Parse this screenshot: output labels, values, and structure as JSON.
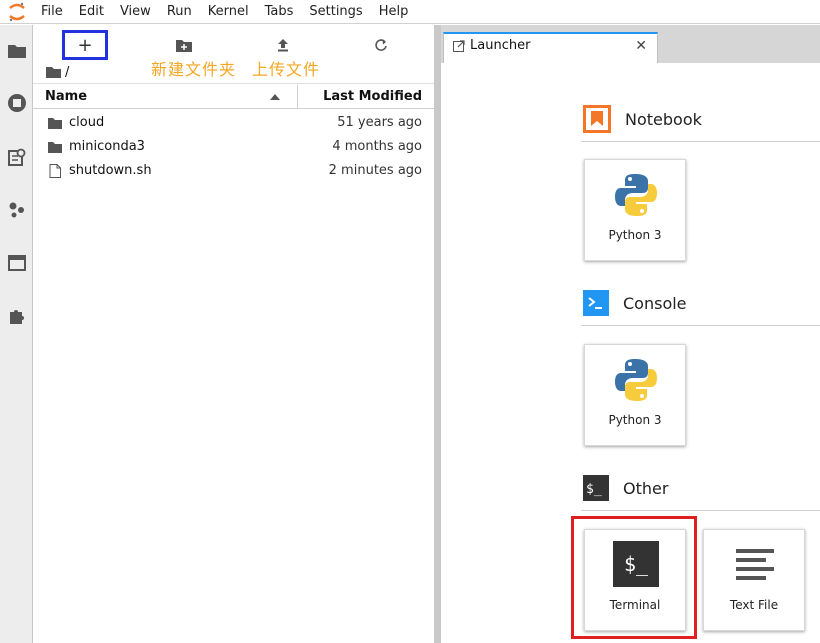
{
  "menubar": {
    "items": [
      "File",
      "Edit",
      "View",
      "Run",
      "Kernel",
      "Tabs",
      "Settings",
      "Help"
    ]
  },
  "filebrowser": {
    "new_button_label": "+",
    "annotations": {
      "new_folder": "新建文件夹",
      "upload": "上传文件"
    },
    "breadcrumb": "/",
    "columns": {
      "name": "Name",
      "modified": "Last Modified"
    },
    "files": [
      {
        "name": "cloud",
        "modified": "51 years ago",
        "type": "folder"
      },
      {
        "name": "miniconda3",
        "modified": "4 months ago",
        "type": "folder"
      },
      {
        "name": "shutdown.sh",
        "modified": "2 minutes ago",
        "type": "file"
      }
    ]
  },
  "tabs": [
    {
      "label": "Launcher",
      "close": "✕"
    }
  ],
  "launcher": {
    "sections": {
      "notebook": {
        "title": "Notebook",
        "card": "Python 3"
      },
      "console": {
        "title": "Console",
        "card": "Python 3"
      },
      "other": {
        "title": "Other",
        "cards": [
          "Terminal",
          "Text File"
        ]
      }
    },
    "terminal_glyph": "$_",
    "colors": {
      "notebook_orange": "#f37726",
      "console_blue": "#2196f3",
      "highlight_red": "#e02020",
      "new_button_blue": "#2233dd",
      "annotation_orange": "#f5a623"
    }
  }
}
